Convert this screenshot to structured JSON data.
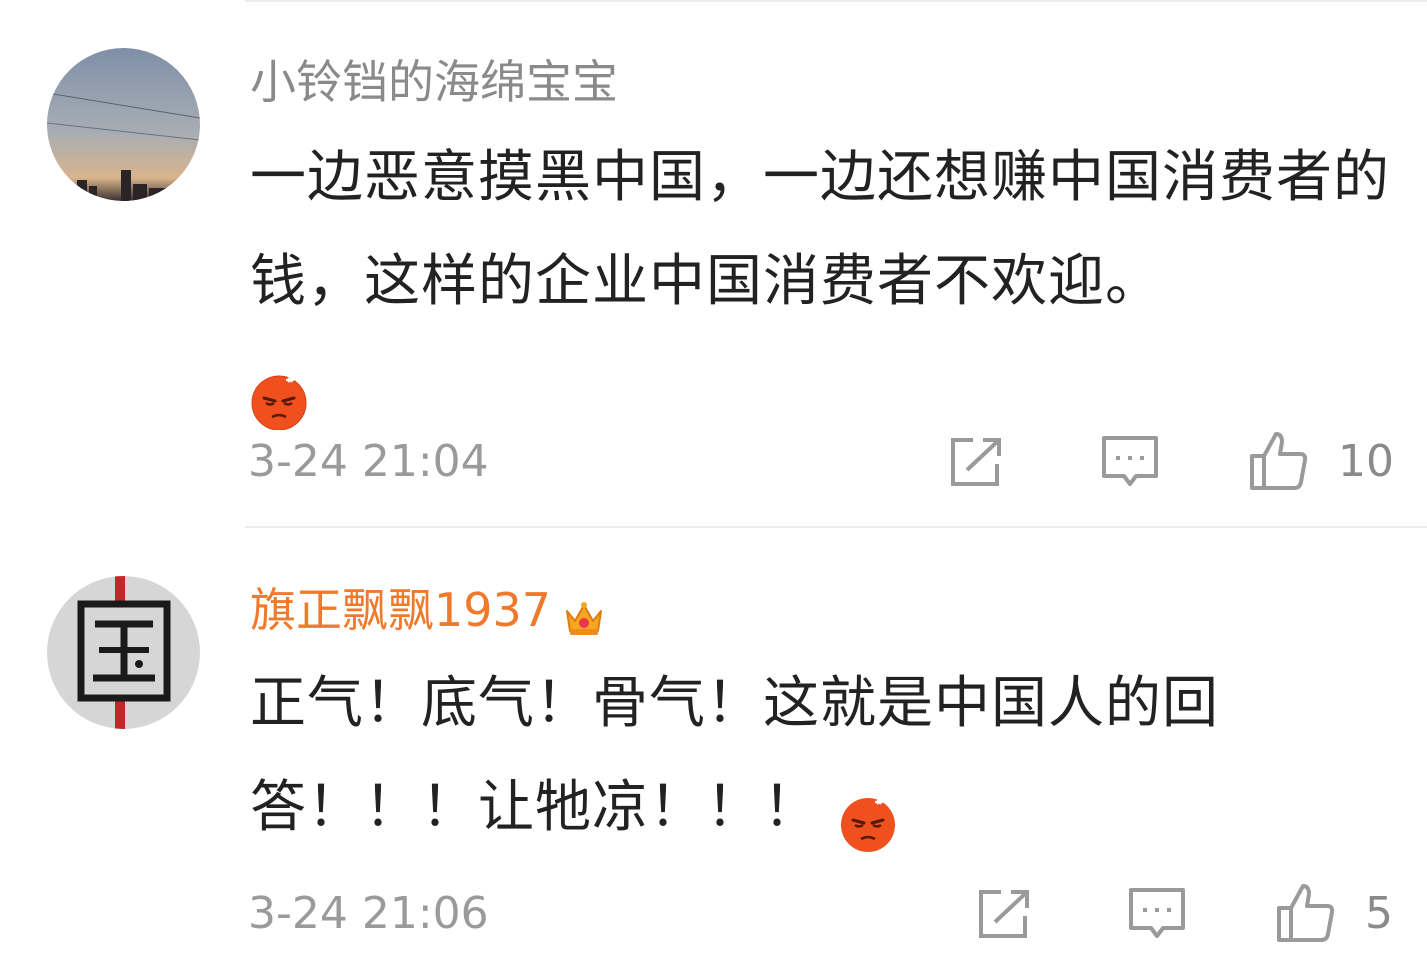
{
  "comments": [
    {
      "username": "小铃铛的海绵宝宝",
      "content": "一边恶意摸黑中国，一边还想赚中国消费者的钱，这样的企业中国消费者不欢迎。",
      "emoji": "angry-face-emoji",
      "timestamp": "3-24 21:04",
      "likes": "10",
      "vip": false,
      "avatar": "city-skyline-sunset"
    },
    {
      "username": "旗正飘飘1937",
      "content": "正气！底气！骨气！这就是中国人的回答！！！让牠凉！！！",
      "emoji": "angry-face-emoji",
      "timestamp": "3-24 21:06",
      "likes": "5",
      "vip": true,
      "badge": "crown-icon",
      "avatar": "guo-character"
    }
  ],
  "colors": {
    "username_normal": "#8a8a8a",
    "username_vip": "#f07a2c",
    "content": "#222222",
    "meta": "#9a9a9a",
    "icon": "#9a9a9a",
    "emoji": "#f0501e"
  },
  "icons": [
    "share-icon",
    "comment-icon",
    "like-icon",
    "angry-face-emoji",
    "crown-icon"
  ]
}
